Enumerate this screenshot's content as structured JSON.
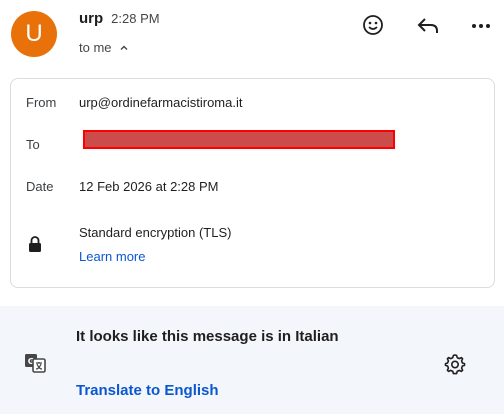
{
  "header": {
    "avatar_letter": "U",
    "avatar_color": "#e8710a",
    "sender": "urp",
    "time": "2:28 PM",
    "recipient_summary": "to me",
    "icons": [
      "emoji-icon",
      "reply-icon",
      "more-icon"
    ]
  },
  "details": {
    "from_label": "From",
    "from_value": "urp@ordinefarmacistiroma.it",
    "to_label": "To",
    "date_label": "Date",
    "date_value": "12 Feb 2026 at 2:28 PM",
    "encryption_text": "Standard encryption (TLS)",
    "learn_more": "Learn more"
  },
  "translate": {
    "message": "It looks like this message is in Italian",
    "action": "Translate to English",
    "accent_color": "#0b57d0"
  }
}
